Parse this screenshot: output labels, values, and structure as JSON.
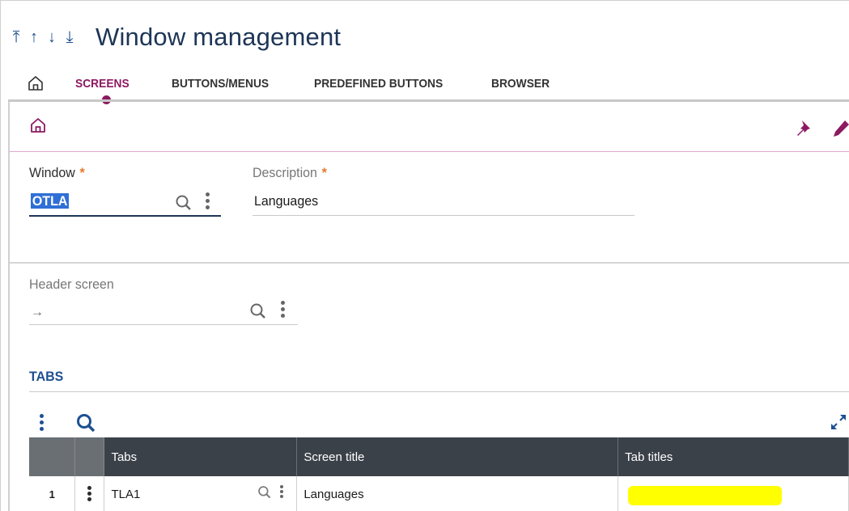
{
  "header": {
    "nav_arrows": {
      "first": "⤒",
      "up": "↑",
      "down": "↓",
      "last": "⤓"
    },
    "title": "Window management"
  },
  "nav_tabs": [
    {
      "label": "SCREENS",
      "active": true
    },
    {
      "label": "BUTTONS/MENUS",
      "active": false
    },
    {
      "label": "PREDEFINED BUTTONS",
      "active": false
    },
    {
      "label": "BROWSER",
      "active": false
    }
  ],
  "form": {
    "window": {
      "label": "Window",
      "required_mark": "*",
      "value": "OTLA"
    },
    "description": {
      "label": "Description",
      "required_mark": "*",
      "value": "Languages"
    },
    "header_screen": {
      "label": "Header screen",
      "value": "→"
    }
  },
  "tabs_section": {
    "title": "TABS",
    "columns": [
      "Tabs",
      "Screen title",
      "Tab titles"
    ],
    "rows": [
      {
        "num": "1",
        "tab": "TLA1",
        "screen_title": "Languages",
        "tab_titles": ""
      }
    ]
  },
  "colors": {
    "accent": "#8c1a61",
    "title_blue": "#1d3557",
    "link_blue": "#1d4f91",
    "required": "#e8782a",
    "grid_header": "#3b4149",
    "highlight": "#ffff00"
  },
  "icons": [
    "home-icon",
    "pin-icon",
    "pencil-icon",
    "search-icon",
    "kebab-icon",
    "expand-icon"
  ]
}
